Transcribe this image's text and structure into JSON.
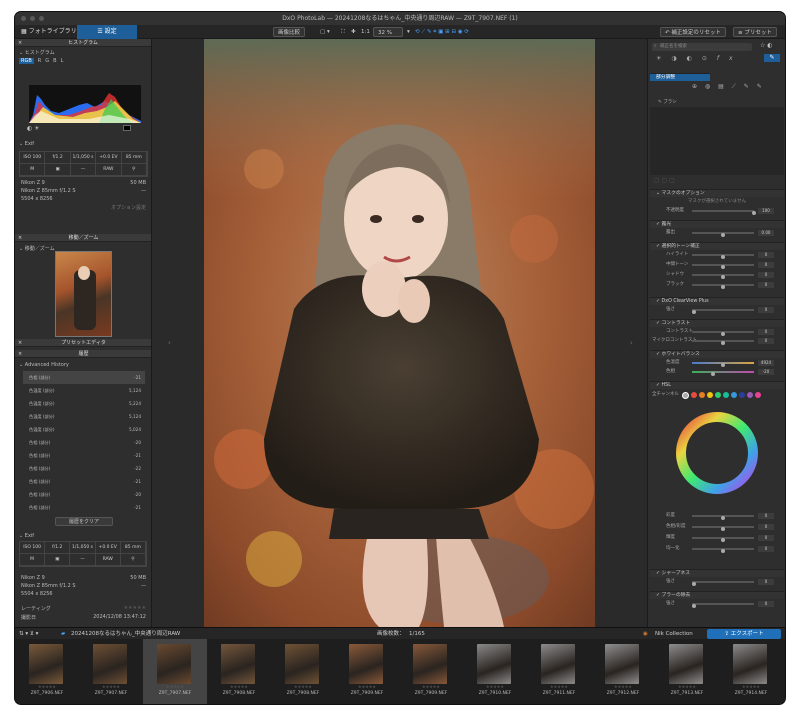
{
  "window_title": "DxO PhotoLab — 20241208なるはちゃん_中央通り周辺RAW — Z9T_7907.NEF (1)",
  "tabs": {
    "library": "フォトライブラリ",
    "customize": "設定"
  },
  "toolbar": {
    "compare": "画像比較",
    "zoom_fit": "1:1",
    "zoom": "32 %",
    "reset": "補正設定のリセット",
    "preset": "プリセット"
  },
  "left": {
    "histogram_title": "ヒストグラム",
    "histogram_label": "ヒストグラム",
    "channels": [
      "RGB",
      "R",
      "G",
      "B",
      "L"
    ],
    "exif_title": "Exif",
    "exif_values": [
      "ISO 100",
      "f/1.2",
      "1/1,050 s",
      "+0.0 EV",
      "85 mm",
      "M",
      "",
      "—",
      "RAW",
      ""
    ],
    "camera": "Nikon Z 9",
    "lens": "Nikon Z 85mm f/1.2 S",
    "file_size": "50 MB",
    "dimensions": "5504 x 8256",
    "options": "オプション設定",
    "move_zoom_title": "移動／ズーム",
    "move_zoom_label": "移動／ズーム",
    "preset_editor_title": "プリセットエディタ",
    "history_title": "履歴",
    "advanced_history": "Advanced History",
    "history": [
      {
        "name": "色相 (部分)",
        "value": "-21"
      },
      {
        "name": "色温度 (部分)",
        "value": "5,124"
      },
      {
        "name": "色温度 (部分)",
        "value": "5,224"
      },
      {
        "name": "色温度 (部分)",
        "value": "5,124"
      },
      {
        "name": "色温度 (部分)",
        "value": "5,024"
      },
      {
        "name": "色相 (部分)",
        "value": "-20"
      },
      {
        "name": "色相 (部分)",
        "value": "-21"
      },
      {
        "name": "色相 (部分)",
        "value": "-22"
      },
      {
        "name": "色相 (部分)",
        "value": "-21"
      },
      {
        "name": "色相 (部分)",
        "value": "-20"
      },
      {
        "name": "色相 (部分)",
        "value": "-21"
      }
    ],
    "clear_history": "履歴をクリア",
    "exif2_title": "Exif",
    "rating_label": "レーティング",
    "shot_date_label": "撮影日",
    "shot_date": "2024/12/08 13:47:12"
  },
  "right": {
    "search_placeholder": "補正名を検索",
    "local_adjust": "部分調整",
    "brush": "ブラシ",
    "mask_options": "マスクのオプション",
    "mask_none": "マスクが選択されていません",
    "opacity_label": "不透明度",
    "opacity": "100",
    "exposure_head": "露光",
    "exposure_label": "露出",
    "exposure": "0.00",
    "tone_head": "選択的トーン補正",
    "tones": [
      {
        "label": "ハイライト",
        "value": "0"
      },
      {
        "label": "中間トーン",
        "value": "0"
      },
      {
        "label": "シャドウ",
        "value": "0"
      },
      {
        "label": "ブラック",
        "value": "0"
      }
    ],
    "clearview_head": "DxO ClearView Plus",
    "clearview_label": "強さ",
    "clearview": "0",
    "contrast_head": "コントラスト",
    "contrast_label": "コントラスト",
    "contrast": "0",
    "micro_label": "マイクロコントラスト",
    "micro": "0",
    "wb_head": "ホワイトバランス",
    "temp_label": "色温度",
    "temp": "4924",
    "tint_label": "色相",
    "tint": "-20",
    "hsl_head": "HSL",
    "all_channels": "全チャンネル",
    "swatch_colors": [
      "#aaaaaa",
      "#e74c3c",
      "#e67e22",
      "#f1c40f",
      "#2ecc71",
      "#1abc9c",
      "#3498db",
      "#2c3e99",
      "#9b59b6",
      "#e84393"
    ],
    "hsl_sliders": [
      {
        "label": "彩度",
        "value": "0"
      },
      {
        "label": "色相/彩度",
        "value": "0"
      },
      {
        "label": "輝度",
        "value": "0"
      },
      {
        "label": "均一化",
        "value": "0"
      }
    ],
    "sharp_head": "シャープネス",
    "sharp_label": "強さ",
    "sharp": "0",
    "blur_head": "ブラーの除去",
    "blur_label": "強さ",
    "blur": "0"
  },
  "filmstrip": {
    "folder": "20241208なるはちゃん_中央通り周辺RAW",
    "count_label": "画像枚数：",
    "count": "1/165",
    "nik": "Nik Collection",
    "export": "エクスポート",
    "thumbs": [
      {
        "name": "Z9T_7906.NEF",
        "color": "#7a5a3a"
      },
      {
        "name": "Z9T_7907.NEF",
        "color": "#6e4f34"
      },
      {
        "name": "Z9T_7907.NEF",
        "color": "#6a4a30"
      },
      {
        "name": "Z9T_7908.NEF",
        "color": "#74563b"
      },
      {
        "name": "Z9T_7908.NEF",
        "color": "#705235"
      },
      {
        "name": "Z9T_7909.NEF",
        "color": "#8a5a3a"
      },
      {
        "name": "Z9T_7909.NEF",
        "color": "#86583a"
      },
      {
        "name": "Z9T_7910.NEF",
        "color": "#8a8a8a"
      },
      {
        "name": "Z9T_7911.NEF",
        "color": "#8c8c8c"
      },
      {
        "name": "Z9T_7912.NEF",
        "color": "#909090"
      },
      {
        "name": "Z9T_7913.NEF",
        "color": "#8e8e8e"
      },
      {
        "name": "Z9T_7914.NEF",
        "color": "#8b8b8b"
      }
    ]
  }
}
